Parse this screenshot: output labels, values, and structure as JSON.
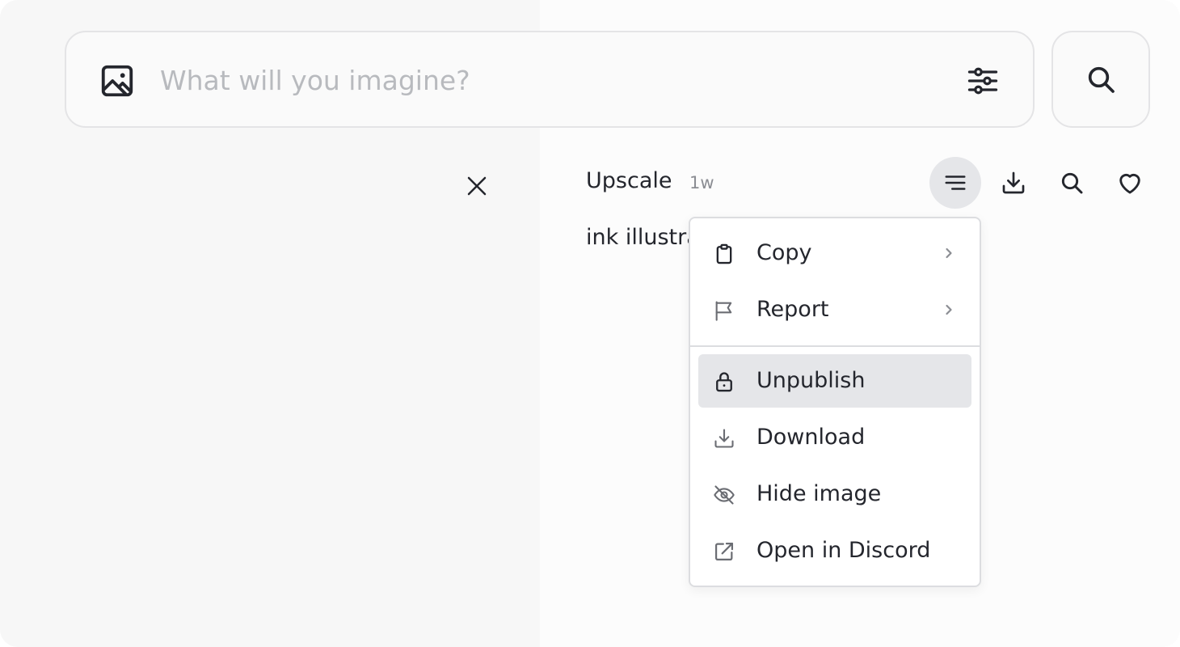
{
  "search": {
    "placeholder": "What will you imagine?",
    "value": ""
  },
  "icons": {
    "image": "image-icon",
    "settings": "sliders-icon",
    "search": "search-icon",
    "close": "close-icon",
    "options": "menu-lines-icon",
    "download": "download-icon",
    "zoom": "search-icon",
    "like": "heart-icon"
  },
  "job": {
    "type": "Upscale",
    "age": "1w",
    "prompt": "ink illustra"
  },
  "menu": {
    "items": [
      {
        "label": "Copy",
        "icon": "clipboard-icon",
        "has_submenu": true
      },
      {
        "label": "Report",
        "icon": "flag-icon",
        "has_submenu": true
      },
      {
        "label": "Unpublish",
        "icon": "lock-icon",
        "active": true
      },
      {
        "label": "Download",
        "icon": "download-icon"
      },
      {
        "label": "Hide image",
        "icon": "eye-off-icon"
      },
      {
        "label": "Open in Discord",
        "icon": "external-link-icon"
      }
    ]
  },
  "colors": {
    "text": "#24262d",
    "muted": "#8b8d93",
    "placeholder": "#b8babe",
    "active_bg": "#e5e6e9",
    "border": "#dcdde0"
  }
}
